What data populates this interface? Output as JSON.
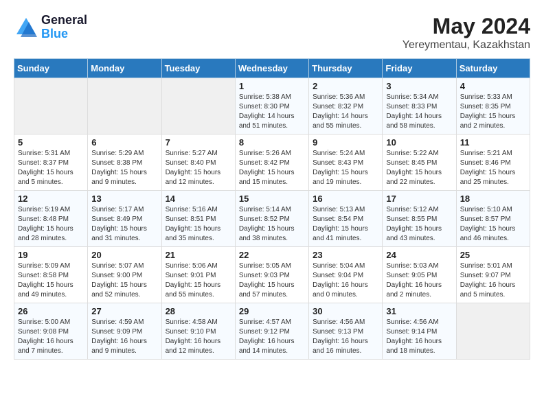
{
  "header": {
    "logo_line1": "General",
    "logo_line2": "Blue",
    "month": "May 2024",
    "location": "Yereymentau, Kazakhstan"
  },
  "weekdays": [
    "Sunday",
    "Monday",
    "Tuesday",
    "Wednesday",
    "Thursday",
    "Friday",
    "Saturday"
  ],
  "weeks": [
    [
      {
        "day": "",
        "sunrise": "",
        "sunset": "",
        "daylight": ""
      },
      {
        "day": "",
        "sunrise": "",
        "sunset": "",
        "daylight": ""
      },
      {
        "day": "",
        "sunrise": "",
        "sunset": "",
        "daylight": ""
      },
      {
        "day": "1",
        "sunrise": "Sunrise: 5:38 AM",
        "sunset": "Sunset: 8:30 PM",
        "daylight": "Daylight: 14 hours and 51 minutes."
      },
      {
        "day": "2",
        "sunrise": "Sunrise: 5:36 AM",
        "sunset": "Sunset: 8:32 PM",
        "daylight": "Daylight: 14 hours and 55 minutes."
      },
      {
        "day": "3",
        "sunrise": "Sunrise: 5:34 AM",
        "sunset": "Sunset: 8:33 PM",
        "daylight": "Daylight: 14 hours and 58 minutes."
      },
      {
        "day": "4",
        "sunrise": "Sunrise: 5:33 AM",
        "sunset": "Sunset: 8:35 PM",
        "daylight": "Daylight: 15 hours and 2 minutes."
      }
    ],
    [
      {
        "day": "5",
        "sunrise": "Sunrise: 5:31 AM",
        "sunset": "Sunset: 8:37 PM",
        "daylight": "Daylight: 15 hours and 5 minutes."
      },
      {
        "day": "6",
        "sunrise": "Sunrise: 5:29 AM",
        "sunset": "Sunset: 8:38 PM",
        "daylight": "Daylight: 15 hours and 9 minutes."
      },
      {
        "day": "7",
        "sunrise": "Sunrise: 5:27 AM",
        "sunset": "Sunset: 8:40 PM",
        "daylight": "Daylight: 15 hours and 12 minutes."
      },
      {
        "day": "8",
        "sunrise": "Sunrise: 5:26 AM",
        "sunset": "Sunset: 8:42 PM",
        "daylight": "Daylight: 15 hours and 15 minutes."
      },
      {
        "day": "9",
        "sunrise": "Sunrise: 5:24 AM",
        "sunset": "Sunset: 8:43 PM",
        "daylight": "Daylight: 15 hours and 19 minutes."
      },
      {
        "day": "10",
        "sunrise": "Sunrise: 5:22 AM",
        "sunset": "Sunset: 8:45 PM",
        "daylight": "Daylight: 15 hours and 22 minutes."
      },
      {
        "day": "11",
        "sunrise": "Sunrise: 5:21 AM",
        "sunset": "Sunset: 8:46 PM",
        "daylight": "Daylight: 15 hours and 25 minutes."
      }
    ],
    [
      {
        "day": "12",
        "sunrise": "Sunrise: 5:19 AM",
        "sunset": "Sunset: 8:48 PM",
        "daylight": "Daylight: 15 hours and 28 minutes."
      },
      {
        "day": "13",
        "sunrise": "Sunrise: 5:17 AM",
        "sunset": "Sunset: 8:49 PM",
        "daylight": "Daylight: 15 hours and 31 minutes."
      },
      {
        "day": "14",
        "sunrise": "Sunrise: 5:16 AM",
        "sunset": "Sunset: 8:51 PM",
        "daylight": "Daylight: 15 hours and 35 minutes."
      },
      {
        "day": "15",
        "sunrise": "Sunrise: 5:14 AM",
        "sunset": "Sunset: 8:52 PM",
        "daylight": "Daylight: 15 hours and 38 minutes."
      },
      {
        "day": "16",
        "sunrise": "Sunrise: 5:13 AM",
        "sunset": "Sunset: 8:54 PM",
        "daylight": "Daylight: 15 hours and 41 minutes."
      },
      {
        "day": "17",
        "sunrise": "Sunrise: 5:12 AM",
        "sunset": "Sunset: 8:55 PM",
        "daylight": "Daylight: 15 hours and 43 minutes."
      },
      {
        "day": "18",
        "sunrise": "Sunrise: 5:10 AM",
        "sunset": "Sunset: 8:57 PM",
        "daylight": "Daylight: 15 hours and 46 minutes."
      }
    ],
    [
      {
        "day": "19",
        "sunrise": "Sunrise: 5:09 AM",
        "sunset": "Sunset: 8:58 PM",
        "daylight": "Daylight: 15 hours and 49 minutes."
      },
      {
        "day": "20",
        "sunrise": "Sunrise: 5:07 AM",
        "sunset": "Sunset: 9:00 PM",
        "daylight": "Daylight: 15 hours and 52 minutes."
      },
      {
        "day": "21",
        "sunrise": "Sunrise: 5:06 AM",
        "sunset": "Sunset: 9:01 PM",
        "daylight": "Daylight: 15 hours and 55 minutes."
      },
      {
        "day": "22",
        "sunrise": "Sunrise: 5:05 AM",
        "sunset": "Sunset: 9:03 PM",
        "daylight": "Daylight: 15 hours and 57 minutes."
      },
      {
        "day": "23",
        "sunrise": "Sunrise: 5:04 AM",
        "sunset": "Sunset: 9:04 PM",
        "daylight": "Daylight: 16 hours and 0 minutes."
      },
      {
        "day": "24",
        "sunrise": "Sunrise: 5:03 AM",
        "sunset": "Sunset: 9:05 PM",
        "daylight": "Daylight: 16 hours and 2 minutes."
      },
      {
        "day": "25",
        "sunrise": "Sunrise: 5:01 AM",
        "sunset": "Sunset: 9:07 PM",
        "daylight": "Daylight: 16 hours and 5 minutes."
      }
    ],
    [
      {
        "day": "26",
        "sunrise": "Sunrise: 5:00 AM",
        "sunset": "Sunset: 9:08 PM",
        "daylight": "Daylight: 16 hours and 7 minutes."
      },
      {
        "day": "27",
        "sunrise": "Sunrise: 4:59 AM",
        "sunset": "Sunset: 9:09 PM",
        "daylight": "Daylight: 16 hours and 9 minutes."
      },
      {
        "day": "28",
        "sunrise": "Sunrise: 4:58 AM",
        "sunset": "Sunset: 9:10 PM",
        "daylight": "Daylight: 16 hours and 12 minutes."
      },
      {
        "day": "29",
        "sunrise": "Sunrise: 4:57 AM",
        "sunset": "Sunset: 9:12 PM",
        "daylight": "Daylight: 16 hours and 14 minutes."
      },
      {
        "day": "30",
        "sunrise": "Sunrise: 4:56 AM",
        "sunset": "Sunset: 9:13 PM",
        "daylight": "Daylight: 16 hours and 16 minutes."
      },
      {
        "day": "31",
        "sunrise": "Sunrise: 4:56 AM",
        "sunset": "Sunset: 9:14 PM",
        "daylight": "Daylight: 16 hours and 18 minutes."
      },
      {
        "day": "",
        "sunrise": "",
        "sunset": "",
        "daylight": ""
      }
    ]
  ]
}
